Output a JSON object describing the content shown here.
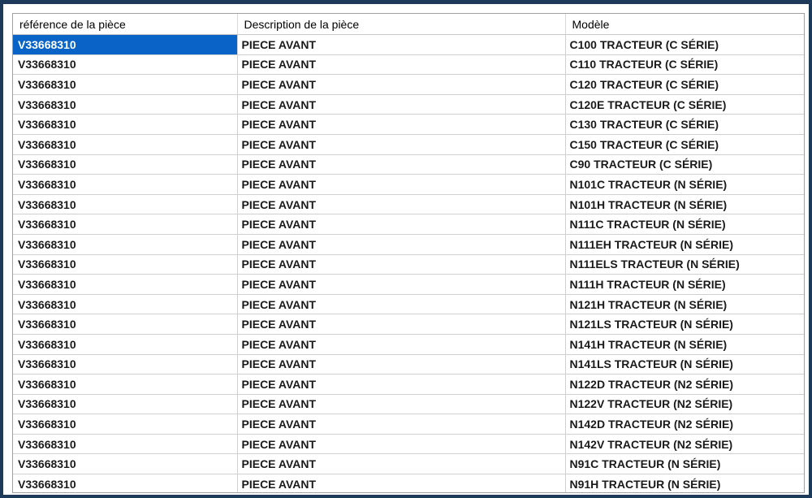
{
  "columns": {
    "ref": "référence  de la pièce",
    "desc": "Description de la pièce",
    "model": "Modèle"
  },
  "rows": [
    {
      "ref": "V33668310",
      "desc": "PIECE AVANT",
      "model": "C100 TRACTEUR (C SÉRIE)"
    },
    {
      "ref": "V33668310",
      "desc": "PIECE AVANT",
      "model": "C110 TRACTEUR (C SÉRIE)"
    },
    {
      "ref": "V33668310",
      "desc": "PIECE AVANT",
      "model": "C120 TRACTEUR (C SÉRIE)"
    },
    {
      "ref": "V33668310",
      "desc": "PIECE AVANT",
      "model": "C120E TRACTEUR (C SÉRIE)"
    },
    {
      "ref": "V33668310",
      "desc": "PIECE AVANT",
      "model": "C130 TRACTEUR (C SÉRIE)"
    },
    {
      "ref": "V33668310",
      "desc": "PIECE AVANT",
      "model": "C150 TRACTEUR (C SÉRIE)"
    },
    {
      "ref": "V33668310",
      "desc": "PIECE AVANT",
      "model": "C90 TRACTEUR (C SÉRIE)"
    },
    {
      "ref": "V33668310",
      "desc": "PIECE AVANT",
      "model": "N101C TRACTEUR (N SÉRIE)"
    },
    {
      "ref": "V33668310",
      "desc": "PIECE AVANT",
      "model": "N101H TRACTEUR (N SÉRIE)"
    },
    {
      "ref": "V33668310",
      "desc": "PIECE AVANT",
      "model": "N111C TRACTEUR (N SÉRIE)"
    },
    {
      "ref": "V33668310",
      "desc": "PIECE AVANT",
      "model": "N111EH TRACTEUR (N SÉRIE)"
    },
    {
      "ref": "V33668310",
      "desc": "PIECE AVANT",
      "model": "N111ELS TRACTEUR (N SÉRIE)"
    },
    {
      "ref": "V33668310",
      "desc": "PIECE AVANT",
      "model": "N111H TRACTEUR (N SÉRIE)"
    },
    {
      "ref": "V33668310",
      "desc": "PIECE AVANT",
      "model": "N121H TRACTEUR (N SÉRIE)"
    },
    {
      "ref": "V33668310",
      "desc": "PIECE AVANT",
      "model": "N121LS TRACTEUR (N SÉRIE)"
    },
    {
      "ref": "V33668310",
      "desc": "PIECE AVANT",
      "model": "N141H TRACTEUR (N SÉRIE)"
    },
    {
      "ref": "V33668310",
      "desc": "PIECE AVANT",
      "model": "N141LS TRACTEUR (N SÉRIE)"
    },
    {
      "ref": "V33668310",
      "desc": "PIECE AVANT",
      "model": "N122D TRACTEUR (N2 SÉRIE)"
    },
    {
      "ref": "V33668310",
      "desc": "PIECE AVANT",
      "model": "N122V TRACTEUR (N2 SÉRIE)"
    },
    {
      "ref": "V33668310",
      "desc": "PIECE AVANT",
      "model": "N142D TRACTEUR (N2 SÉRIE)"
    },
    {
      "ref": "V33668310",
      "desc": "PIECE AVANT",
      "model": "N142V TRACTEUR (N2 SÉRIE)"
    },
    {
      "ref": "V33668310",
      "desc": "PIECE AVANT",
      "model": "N91C TRACTEUR (N SÉRIE)"
    },
    {
      "ref": "V33668310",
      "desc": "PIECE AVANT",
      "model": "N91H TRACTEUR (N SÉRIE)"
    }
  ],
  "selected_row": 0,
  "colors": {
    "frame": "#1e3a5a",
    "selection": "#0a64c8",
    "gridline": "#d0d0d0"
  }
}
